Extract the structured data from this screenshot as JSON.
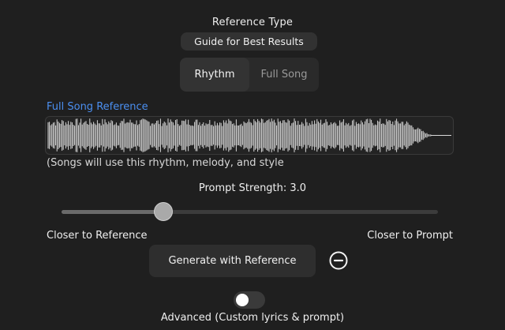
{
  "reference": {
    "title": "Reference Type",
    "guide_label": "Guide for Best Results",
    "tabs": [
      {
        "label": "Rhythm",
        "active": true
      },
      {
        "label": "Full Song",
        "active": false
      }
    ]
  },
  "waveform": {
    "label": "Full Song Reference",
    "caption": "(Songs will use this rhythm, melody, and style",
    "color": "#d9d9d9"
  },
  "prompt_strength": {
    "label": "Prompt Strength: 3.0",
    "value": 3.0,
    "fraction": 0.27,
    "left_label": "Closer to Reference",
    "right_label": "Closer to Prompt"
  },
  "actions": {
    "generate_label": "Generate with Reference",
    "remove_icon": "minus-circle-icon"
  },
  "advanced": {
    "label": "Advanced (Custom lyrics & prompt)",
    "enabled": false
  },
  "colors": {
    "accent": "#4b8ff0",
    "background": "#1f1f1f"
  }
}
